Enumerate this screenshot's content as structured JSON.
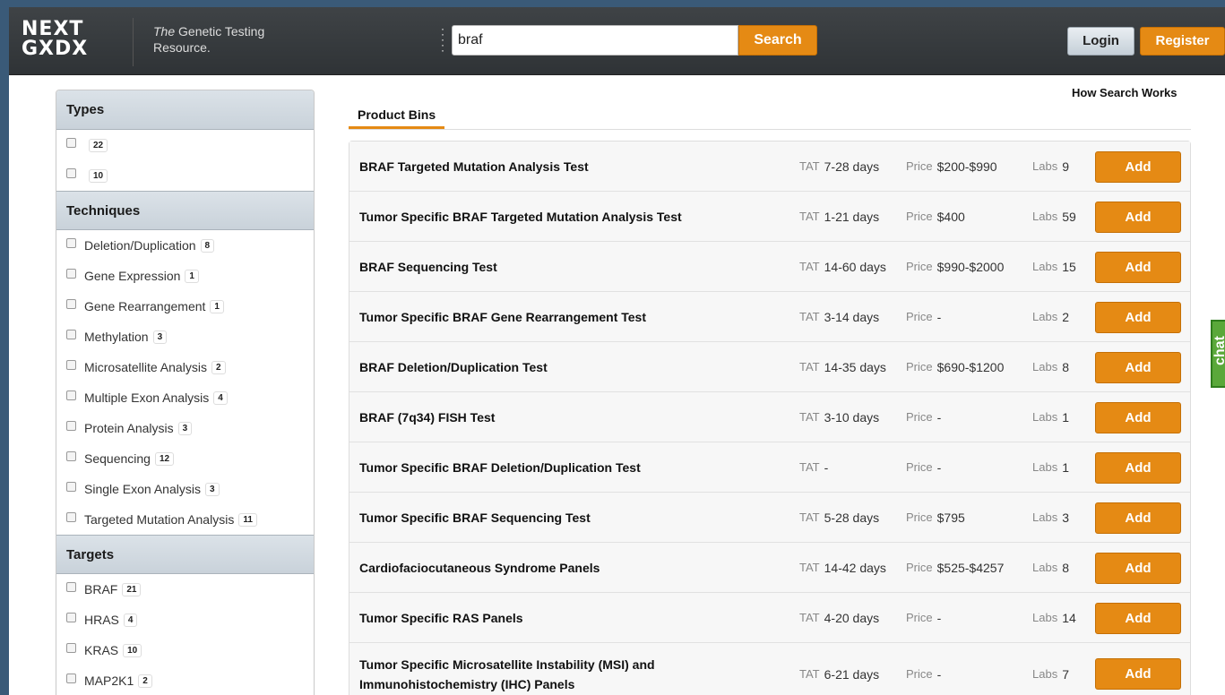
{
  "header": {
    "logo_line1": "NEXT",
    "logo_line2": "GXDX",
    "tagline_italic": "The",
    "tagline_rest": " Genetic Testing Resource.",
    "search_value": "braf",
    "search_button": "Search",
    "login": "Login",
    "register": "Register"
  },
  "sidebar": {
    "types": {
      "title": "Types",
      "items": [
        {
          "label": "",
          "count": "22"
        },
        {
          "label": "",
          "count": "10"
        }
      ]
    },
    "techniques": {
      "title": "Techniques",
      "items": [
        {
          "label": "Deletion/Duplication",
          "count": "8"
        },
        {
          "label": "Gene Expression",
          "count": "1"
        },
        {
          "label": "Gene Rearrangement",
          "count": "1"
        },
        {
          "label": "Methylation",
          "count": "3"
        },
        {
          "label": "Microsatellite Analysis",
          "count": "2"
        },
        {
          "label": "Multiple Exon Analysis",
          "count": "4"
        },
        {
          "label": "Protein Analysis",
          "count": "3"
        },
        {
          "label": "Sequencing",
          "count": "12"
        },
        {
          "label": "Single Exon Analysis",
          "count": "3"
        },
        {
          "label": "Targeted Mutation Analysis",
          "count": "11"
        }
      ]
    },
    "targets": {
      "title": "Targets",
      "items": [
        {
          "label": "BRAF",
          "count": "21"
        },
        {
          "label": "HRAS",
          "count": "4"
        },
        {
          "label": "KRAS",
          "count": "10"
        },
        {
          "label": "MAP2K1",
          "count": "2"
        }
      ]
    }
  },
  "main": {
    "tab": "Product Bins",
    "how_link": "How Search Works",
    "labels": {
      "tat": "TAT",
      "price": "Price",
      "labs": "Labs"
    },
    "add_label": "Add",
    "results": [
      {
        "name": "BRAF Targeted Mutation Analysis Test",
        "tat": "7-28 days",
        "price": "$200-$990",
        "labs": "9"
      },
      {
        "name": "Tumor Specific BRAF Targeted Mutation Analysis Test",
        "tat": "1-21 days",
        "price": "$400",
        "labs": "59"
      },
      {
        "name": "BRAF Sequencing Test",
        "tat": "14-60 days",
        "price": "$990-$2000",
        "labs": "15"
      },
      {
        "name": "Tumor Specific BRAF Gene Rearrangement Test",
        "tat": "3-14 days",
        "price": "-",
        "labs": "2"
      },
      {
        "name": "BRAF Deletion/Duplication Test",
        "tat": "14-35 days",
        "price": "$690-$1200",
        "labs": "8"
      },
      {
        "name": "BRAF (7q34) FISH Test",
        "tat": "3-10 days",
        "price": "-",
        "labs": "1"
      },
      {
        "name": "Tumor Specific BRAF Deletion/Duplication Test",
        "tat": "-",
        "price": "-",
        "labs": "1"
      },
      {
        "name": "Tumor Specific BRAF Sequencing Test",
        "tat": "5-28 days",
        "price": "$795",
        "labs": "3"
      },
      {
        "name": "Cardiofaciocutaneous Syndrome Panels",
        "tat": "14-42 days",
        "price": "$525-$4257",
        "labs": "8"
      },
      {
        "name": "Tumor Specific RAS Panels",
        "tat": "4-20 days",
        "price": "-",
        "labs": "14"
      },
      {
        "name": "Tumor Specific Microsatellite Instability (MSI) and Immunohistochemistry (IHC) Panels",
        "tat": "6-21 days",
        "price": "-",
        "labs": "7"
      }
    ]
  },
  "chat": {
    "label": "chat"
  },
  "colors": {
    "accent": "#e58a14",
    "header": "#35393c",
    "frame": "#3a5a78",
    "chat": "#5aa83a"
  }
}
